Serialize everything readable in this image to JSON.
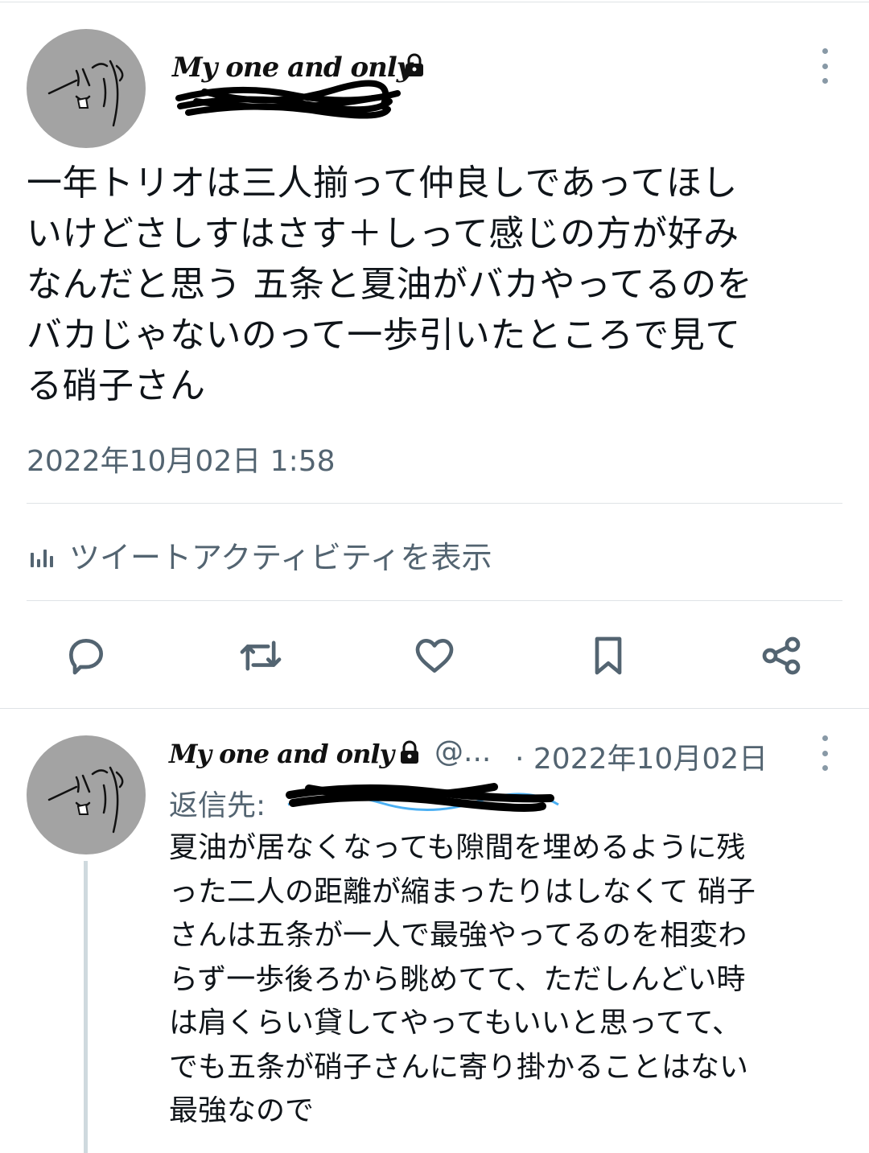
{
  "main_tweet": {
    "display_name": "My one and only",
    "text": "一年トリオは三人揃って仲良しであってほし\nいけどさしすはさす＋しって感じの方が好み\nなんだと思う 五条と夏油がバカやってるのを\nバカじゃないのって一歩引いたところで見て\nる硝子さん",
    "timestamp": "2022年10月02日 1:58",
    "activity_label": "ツイートアクティビティを表示"
  },
  "actions": {
    "icons": [
      "reply-icon",
      "retweet-icon",
      "like-icon",
      "bookmark-icon",
      "share-icon"
    ]
  },
  "reply_tweet": {
    "display_name": "My one and only",
    "handle": "@...",
    "date": "· 2022年10月02日",
    "reply_to_label": "返信先:",
    "text": "夏油が居なくなっても隙間を埋めるように残\nった二人の距離が縮まったりはしなくて 硝子\nさんは五条が一人で最強やってるのを相変わ\nらず一歩後ろから眺めてて、ただしんどい時\nは肩くらい貸してやってもいいと思ってて、\nでも五条が硝子さんに寄り掛かることはない\n最強なので"
  },
  "colors": {
    "text": "#0f1419",
    "muted": "#536471",
    "link": "#1d9bf0",
    "divider": "#dfe3e6",
    "avatar_bg": "#a3a3a3"
  }
}
